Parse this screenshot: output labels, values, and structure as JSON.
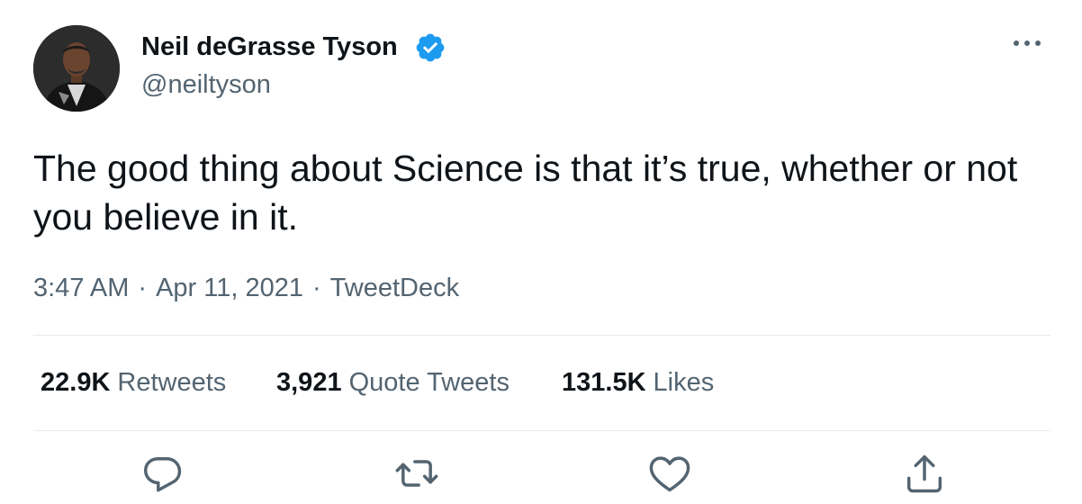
{
  "user": {
    "display_name": "Neil deGrasse Tyson",
    "handle": "@neiltyson",
    "verified": true,
    "verified_color": "#1d9bf0"
  },
  "tweet": {
    "text": "The good thing about Science is that it’s true, whether or not you believe in it.",
    "time": "3:47 AM",
    "date": "Apr 11, 2021",
    "source": "TweetDeck",
    "separator": "·"
  },
  "stats": {
    "retweets": {
      "count": "22.9K",
      "label": "Retweets"
    },
    "quotes": {
      "count": "3,921",
      "label": "Quote Tweets"
    },
    "likes": {
      "count": "131.5K",
      "label": "Likes"
    }
  },
  "actions": [
    {
      "name": "reply-icon"
    },
    {
      "name": "retweet-icon"
    },
    {
      "name": "like-icon"
    },
    {
      "name": "share-icon"
    }
  ],
  "colors": {
    "text": "#0f1419",
    "secondary": "#536471",
    "divider": "#e6ecf0"
  }
}
